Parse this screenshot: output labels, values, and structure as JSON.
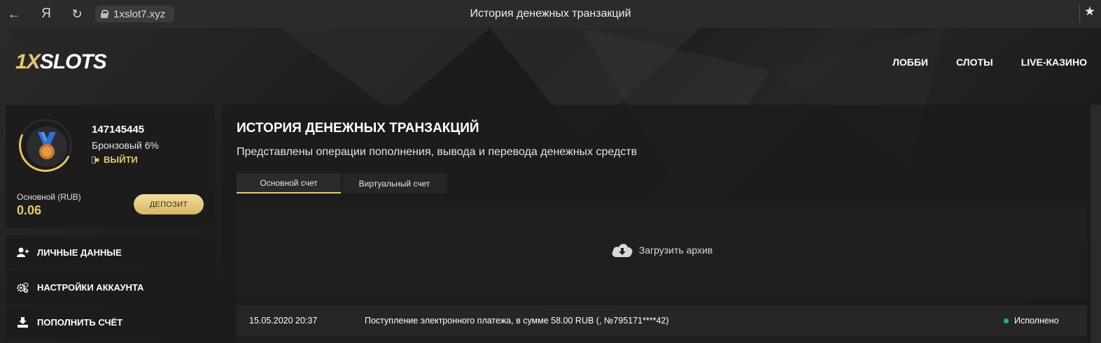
{
  "browser": {
    "url": "1xslot7.xyz",
    "tab_title": "История денежных транзакций",
    "yandex_glyph": "Я"
  },
  "header": {
    "logo_prefix": "1X",
    "logo_suffix": "SLOTS",
    "nav": [
      "ЛОББИ",
      "СЛОТЫ",
      "LIVE-КАЗИНО"
    ]
  },
  "profile": {
    "id": "147145445",
    "level": "Бронзовый 6%",
    "logout": "ВЫЙТИ",
    "balance_label": "Основной (RUB)",
    "balance_value": "0.06",
    "deposit_button": "ДЕПОЗИТ"
  },
  "sidebar": {
    "items": [
      {
        "label": "ЛИЧНЫЕ ДАННЫЕ",
        "icon": "user-add-icon"
      },
      {
        "label": "НАСТРОЙКИ АККАУНТА",
        "icon": "gears-icon"
      },
      {
        "label": "ПОПОЛНИТЬ СЧЁТ",
        "icon": "download-icon"
      }
    ]
  },
  "main": {
    "title": "ИСТОРИЯ ДЕНЕЖНЫХ ТРАНЗАКЦИЙ",
    "subtitle": "Представлены операции пополнения, вывода и перевода денежных средств",
    "tabs": [
      {
        "label": "Основной счет",
        "active": true
      },
      {
        "label": "Виртуальный счет",
        "active": false
      }
    ],
    "archive_label": "Загрузить архив",
    "transactions": [
      {
        "date": "15.05.2020 20:37",
        "description": "Поступление электронного платежа, в сумме 58.00 RUB (, №795171****42)",
        "status": "Исполнено",
        "status_color": "#2db36b"
      }
    ]
  },
  "colors": {
    "accent": "#e7c873",
    "panel": "#1c1c1d"
  }
}
